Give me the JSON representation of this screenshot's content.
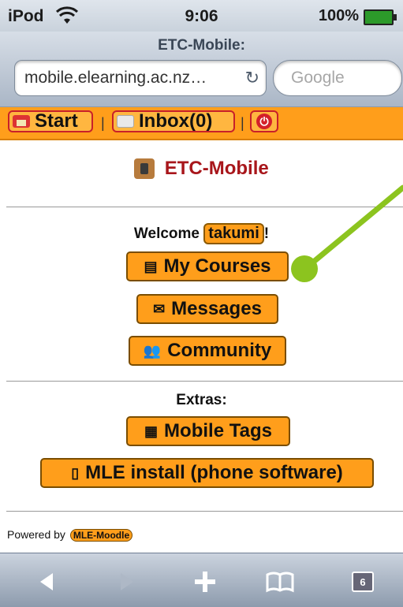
{
  "status": {
    "carrier": "iPod",
    "time": "9:06",
    "battery": "100%"
  },
  "browser": {
    "title": "ETC-Mobile:",
    "url": "mobile.elearning.ac.nz…",
    "search_placeholder": "Google"
  },
  "nav": {
    "start": "Start",
    "inbox": "Inbox(0)",
    "sep": "|"
  },
  "page": {
    "title": "ETC-Mobile",
    "welcome_prefix": "Welcome",
    "username": "takumi",
    "welcome_suffix": "!",
    "buttons": {
      "courses": "My Courses",
      "messages": "Messages",
      "community": "Community"
    },
    "extras_label": "Extras:",
    "extras_buttons": {
      "tags": "Mobile Tags",
      "install": "MLE install (phone software)"
    },
    "powered_by": "Powered by",
    "powered_tag": "MLE-Moodle"
  },
  "toolbar": {
    "tab_count": "6"
  },
  "colors": {
    "accent": "#ff9e1b",
    "title_red": "#a8161b",
    "annotation_green": "#8cc41f"
  }
}
